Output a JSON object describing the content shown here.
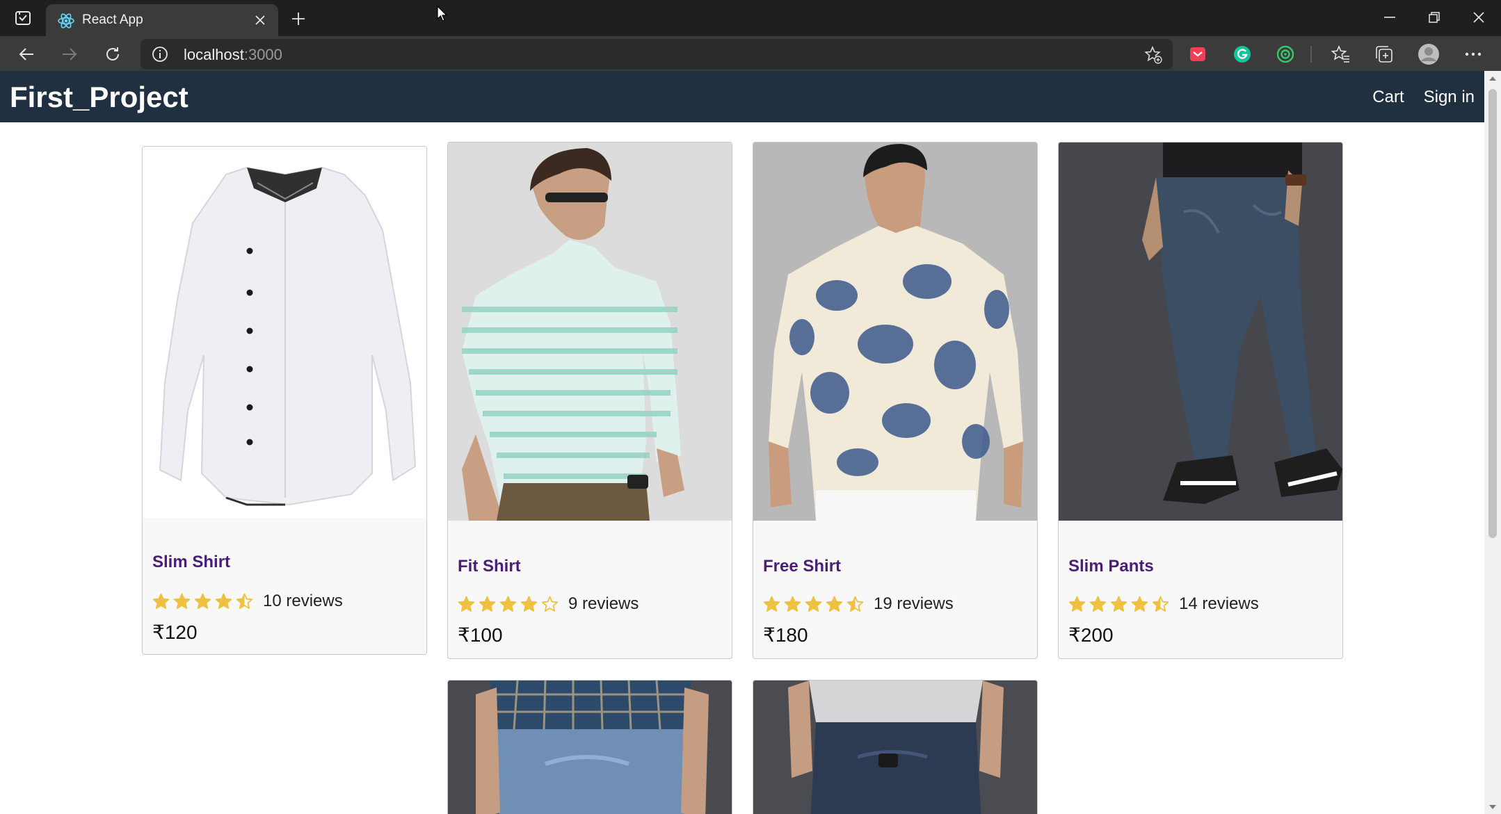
{
  "browser": {
    "tab_title": "React App",
    "url_host": "localhost",
    "url_port": ":3000"
  },
  "app": {
    "brand": "First_Project",
    "nav": {
      "cart": "Cart",
      "signin": "Sign in"
    },
    "currency": "₹"
  },
  "products": [
    {
      "name": "Slim Shirt",
      "rating": 4.5,
      "reviews_text": "10 reviews",
      "price_text": "₹120"
    },
    {
      "name": "Fit Shirt",
      "rating": 4,
      "reviews_text": "9 reviews",
      "price_text": "₹100"
    },
    {
      "name": "Free Shirt",
      "rating": 4.5,
      "reviews_text": "19 reviews",
      "price_text": "₹180"
    },
    {
      "name": "Slim Pants",
      "rating": 4.5,
      "reviews_text": "14 reviews",
      "price_text": "₹200"
    }
  ],
  "colors": {
    "header": "#203040",
    "product_link": "#4b1c7a",
    "star": "#f0c040"
  }
}
